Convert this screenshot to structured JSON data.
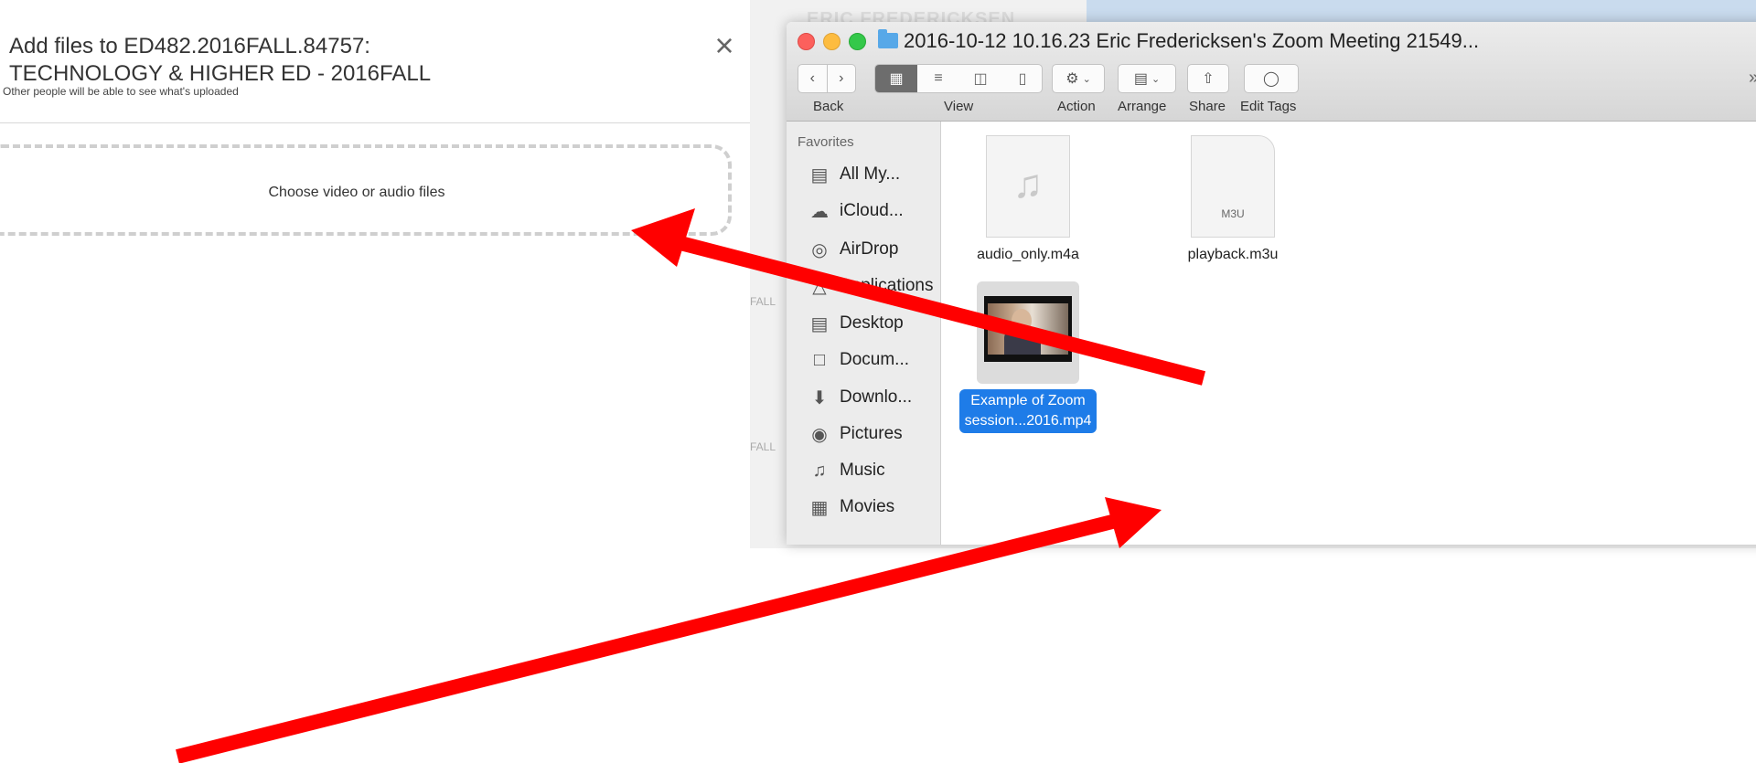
{
  "dialog": {
    "title_line1": "Add files to ED482.2016FALL.84757:",
    "title_line2": "TECHNOLOGY & HIGHER ED - 2016FALL",
    "subtitle": "Other people will be able to see what's uploaded",
    "close_glyph": "×",
    "dropzone_label": "Choose video or audio files"
  },
  "background_page": {
    "name_fragment": "ERIC FREDERICKSEN",
    "fragments": [
      "FALL",
      "FALL"
    ]
  },
  "finder": {
    "window_title": "2016-10-12 10.16.23 Eric Fredericksen's Zoom Meeting 21549...",
    "toolbar": {
      "back_label": "Back",
      "view_label": "View",
      "action_label": "Action",
      "arrange_label": "Arrange",
      "share_label": "Share",
      "edit_tags_label": "Edit Tags",
      "more_glyph": "»"
    },
    "sidebar": {
      "heading": "Favorites",
      "items": [
        {
          "label": "All My...",
          "icon": "all-my-files-icon"
        },
        {
          "label": "iCloud...",
          "icon": "cloud-icon"
        },
        {
          "label": "AirDrop",
          "icon": "airdrop-icon"
        },
        {
          "label": "Applications",
          "icon": "applications-icon"
        },
        {
          "label": "Desktop",
          "icon": "desktop-icon"
        },
        {
          "label": "Docum...",
          "icon": "documents-icon"
        },
        {
          "label": "Downlo...",
          "icon": "downloads-icon"
        },
        {
          "label": "Pictures",
          "icon": "pictures-icon"
        },
        {
          "label": "Music",
          "icon": "music-icon"
        },
        {
          "label": "Movies",
          "icon": "movies-icon"
        }
      ]
    },
    "files": [
      {
        "name": "audio_only.m4a",
        "icon": "audio-file-icon"
      },
      {
        "name": "playback.m3u",
        "icon": "m3u-file-icon",
        "badge": "M3U"
      },
      {
        "name_line1": "Example of Zoom",
        "name_line2": "session...2016.mp4",
        "icon": "video-thumbnail-icon",
        "selected": true
      }
    ]
  },
  "colors": {
    "arrow": "#ff0000",
    "selection": "#1e7ce8"
  }
}
